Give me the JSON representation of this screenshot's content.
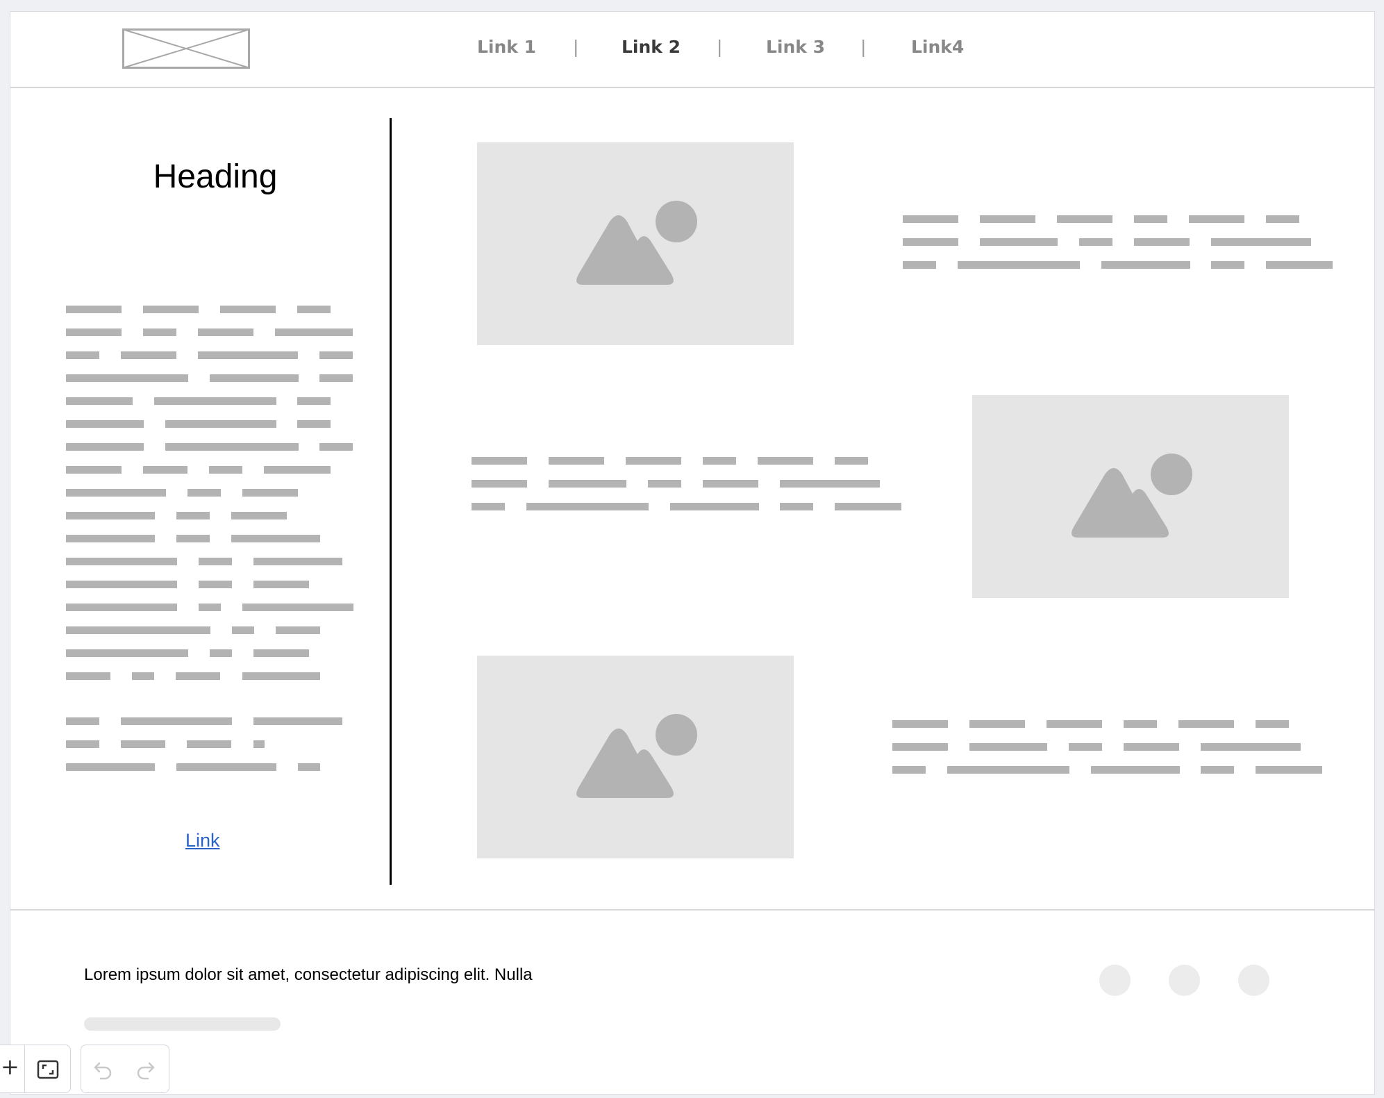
{
  "header": {
    "logo_icon": "image-placeholder-x-icon",
    "nav": [
      {
        "label": "Link 1",
        "active": false
      },
      {
        "label": "Link 2",
        "active": true
      },
      {
        "label": "Link 3",
        "active": false
      },
      {
        "label": "Link4",
        "active": false
      }
    ],
    "separator": "|"
  },
  "left": {
    "heading": "Heading",
    "link": "Link"
  },
  "main": {
    "image_icon": "image-placeholder-icon",
    "blocks": [
      {
        "name": "row-1",
        "image_side": "left"
      },
      {
        "name": "row-2",
        "image_side": "right"
      },
      {
        "name": "row-3",
        "image_side": "left"
      }
    ]
  },
  "footer": {
    "text": "Lorem ipsum dolor sit amet, consectetur adipiscing elit. Nulla",
    "social_icons": [
      "circle-icon",
      "circle-icon",
      "circle-icon"
    ]
  },
  "toolbar": {
    "add_label": "+",
    "fit_icon": "fit-screen-icon",
    "undo_icon": "undo-icon",
    "redo_icon": "redo-icon"
  },
  "colors": {
    "text_placeholder": "#b3b3b3",
    "image_bg": "#e5e5e5",
    "link": "#2a62c9",
    "nav_active": "#3a3a3a",
    "nav_inactive": "#888888"
  }
}
